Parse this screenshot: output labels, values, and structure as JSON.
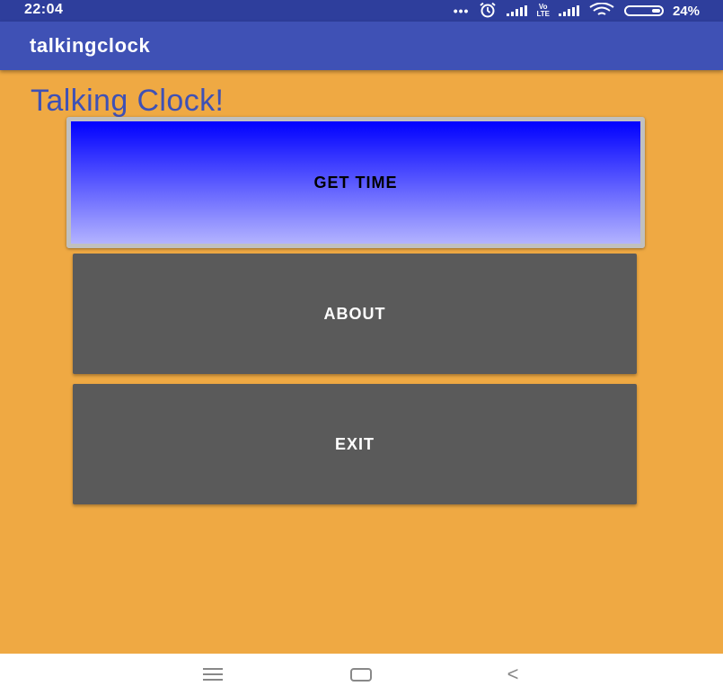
{
  "status_bar": {
    "time": "22:04",
    "battery_percent": "24%",
    "network_label": "Vo₂ LTE",
    "icons": [
      "more-dots-icon",
      "alarm-icon",
      "signal-icon",
      "lte-icon",
      "signal-icon",
      "wifi-icon",
      "battery-icon"
    ]
  },
  "app_bar": {
    "title": "talkingclock"
  },
  "main": {
    "heading": "Talking Clock!",
    "buttons": {
      "get_time": "GET TIME",
      "about": "ABOUT",
      "exit": "EXIT"
    }
  },
  "nav_bar": {
    "icons": [
      "menu-icon",
      "home-icon",
      "back-icon"
    ]
  },
  "colors": {
    "background": "#EFA943",
    "app_bar": "#3F51B5",
    "status_bar": "#2E3E9C",
    "heading": "#3F51B5",
    "gradient_top": "#0000FF",
    "gradient_bottom": "#B3B3FF",
    "button_gray": "#5A5A5A"
  }
}
